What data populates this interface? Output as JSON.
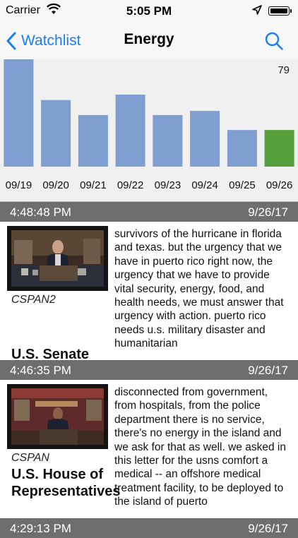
{
  "status_bar": {
    "carrier": "Carrier",
    "time": "5:05 PM"
  },
  "nav": {
    "back_label": "Watchlist",
    "title": "Energy"
  },
  "chart_data": {
    "type": "bar",
    "categories": [
      "09/19",
      "09/20",
      "09/21",
      "09/22",
      "09/23",
      "09/24",
      "09/25",
      "09/26"
    ],
    "values": [
      79,
      49,
      38,
      53,
      38,
      41,
      27,
      27
    ],
    "highlight_index": 7,
    "max_label": "79",
    "ylim": [
      0,
      79
    ],
    "bar_color": "#7f9fd0",
    "highlight_color": "#55a03c",
    "grid": false
  },
  "feed": [
    {
      "time": "4:48:48 PM",
      "date": "9/26/17",
      "channel": "CSPAN2",
      "source": "U.S. Senate",
      "excerpt": "survivors of the hurricane in florida and texas. but the urgency that we have in puerto rico right now, the urgency that we have to provide vital security, energy, food, and health needs, we must answer that urgency with action. puerto rico needs u.s. military disaster and humanitarian"
    },
    {
      "time": "4:46:35 PM",
      "date": "9/26/17",
      "channel": "CSPAN",
      "source": "U.S. House of Representatives",
      "excerpt": "disconnected from government, from hospitals, from the police department there is no service, there's no energy in the island and we ask for that as well. we asked in this letter for the usns comfort a medical -- an offshore medical treatment facility, to be deployed to the island of puerto"
    },
    {
      "time": "4:29:13 PM",
      "date": "9/26/17"
    }
  ]
}
